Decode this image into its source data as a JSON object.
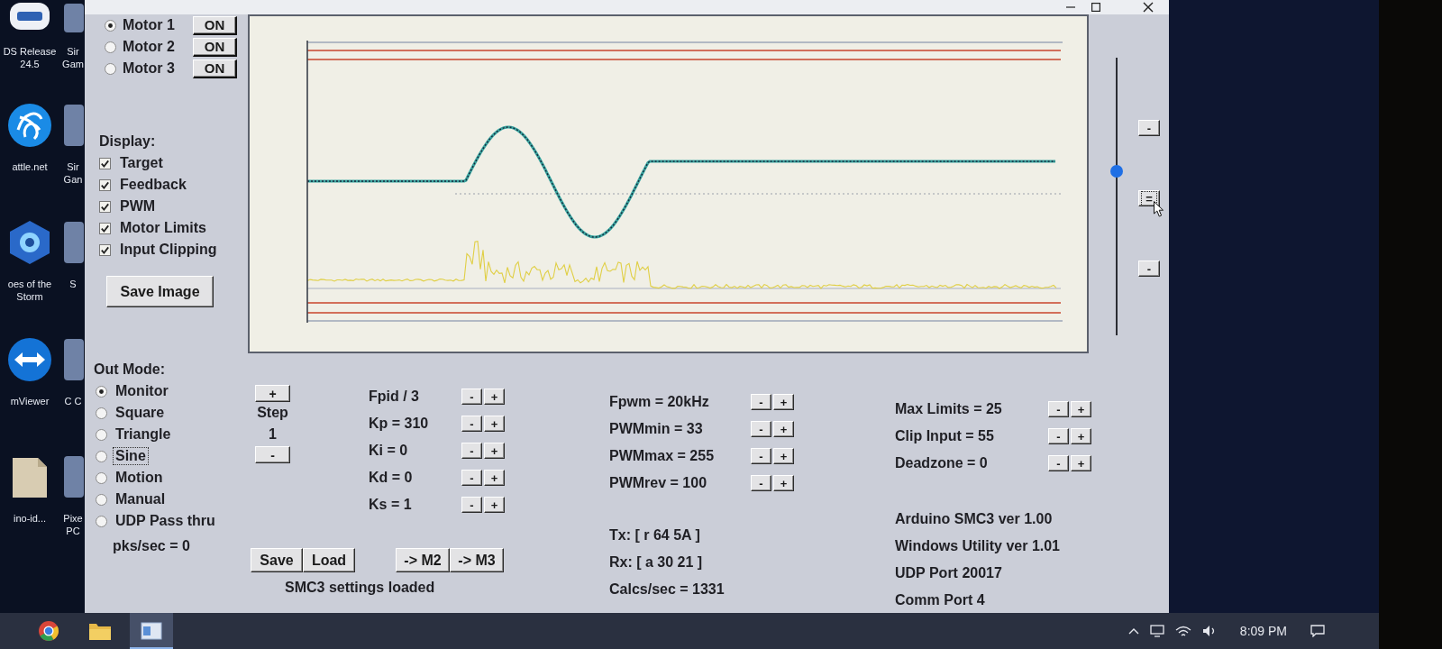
{
  "desktop": {
    "icons": [
      {
        "kind": "badge",
        "label": "DS Release 24.5"
      },
      {
        "kind": "swirl",
        "label": "attle.net"
      },
      {
        "kind": "hexagon",
        "label": "oes of the Storm"
      },
      {
        "kind": "arrows",
        "label": "mViewer"
      },
      {
        "kind": "file",
        "label": "ino-id..."
      }
    ],
    "covered_icons": [
      {
        "label": "Sir Gam"
      },
      {
        "label": "Sir Gan"
      },
      {
        "label": "S"
      },
      {
        "label": "C C"
      },
      {
        "label": "Pixe PC"
      }
    ]
  },
  "window": {
    "motors": [
      {
        "label": "Motor 1",
        "selected": true,
        "toggle": "ON"
      },
      {
        "label": "Motor 2",
        "selected": false,
        "toggle": "ON"
      },
      {
        "label": "Motor 3",
        "selected": false,
        "toggle": "ON"
      }
    ],
    "display": {
      "label": "Display:",
      "items": [
        {
          "label": "Target",
          "checked": true
        },
        {
          "label": "Feedback",
          "checked": true
        },
        {
          "label": "PWM",
          "checked": true
        },
        {
          "label": "Motor Limits",
          "checked": true
        },
        {
          "label": "Input Clipping",
          "checked": true
        }
      ]
    },
    "save_image": "Save Image",
    "zoom": {
      "level": 0.59,
      "buttons": [
        {
          "label": "-",
          "focused": false
        },
        {
          "label": "=",
          "focused": true
        },
        {
          "label": "-",
          "focused": false
        }
      ]
    },
    "out_mode": {
      "label": "Out Mode:",
      "options": [
        {
          "label": "Monitor",
          "selected": true,
          "focused": false
        },
        {
          "label": "Square",
          "selected": false,
          "focused": false
        },
        {
          "label": "Triangle",
          "selected": false,
          "focused": false
        },
        {
          "label": "Sine",
          "selected": false,
          "focused": true
        },
        {
          "label": "Motion",
          "selected": false,
          "focused": false
        },
        {
          "label": "Manual",
          "selected": false,
          "focused": false
        },
        {
          "label": "UDP Pass thru",
          "selected": false,
          "focused": false
        }
      ],
      "rate": "pks/sec = 0"
    },
    "step": {
      "increase": "+",
      "label": "Step",
      "value": "1",
      "decrease": "-"
    },
    "pid": [
      {
        "label": "Fpid / 3",
        "buttons": [
          "-",
          "+"
        ]
      },
      {
        "label": "Kp = 310",
        "buttons": [
          "-",
          "+"
        ]
      },
      {
        "label": "Ki = 0",
        "buttons": [
          "-",
          "+"
        ]
      },
      {
        "label": "Kd = 0",
        "buttons": [
          "-",
          "+"
        ]
      },
      {
        "label": "Ks = 1",
        "buttons": [
          "-",
          "+"
        ]
      }
    ],
    "pwm": [
      {
        "label": "Fpwm = 20kHz",
        "buttons": [
          "-",
          "+"
        ]
      },
      {
        "label": "PWMmin = 33",
        "buttons": [
          "-",
          "+"
        ]
      },
      {
        "label": "PWMmax = 255",
        "buttons": [
          "-",
          "+"
        ]
      },
      {
        "label": "PWMrev = 100",
        "buttons": [
          "-",
          "+"
        ]
      }
    ],
    "limits": [
      {
        "label": "Max Limits = 25",
        "buttons": [
          "-",
          "+"
        ]
      },
      {
        "label": "Clip Input = 55",
        "buttons": [
          "-",
          "+"
        ]
      },
      {
        "label": "Deadzone = 0",
        "buttons": [
          "-",
          "+"
        ]
      }
    ],
    "file_buttons": [
      "Save",
      "Load"
    ],
    "copy_buttons": [
      "-> M2",
      "-> M3"
    ],
    "status": "SMC3 settings loaded",
    "comms": [
      "Tx: [ r 64 5A ]",
      "Rx: [ a 30 21 ]",
      "Calcs/sec = 1331"
    ],
    "info": [
      "Arduino SMC3 ver 1.00",
      "Windows Utility ver 1.01",
      "UDP Port 20017",
      "Comm Port 4"
    ]
  },
  "taskbar": {
    "apps": [
      {
        "kind": "browser",
        "active": false
      },
      {
        "kind": "folder",
        "active": false
      },
      {
        "kind": "window",
        "active": true
      }
    ],
    "clock": "8:09 PM"
  }
}
